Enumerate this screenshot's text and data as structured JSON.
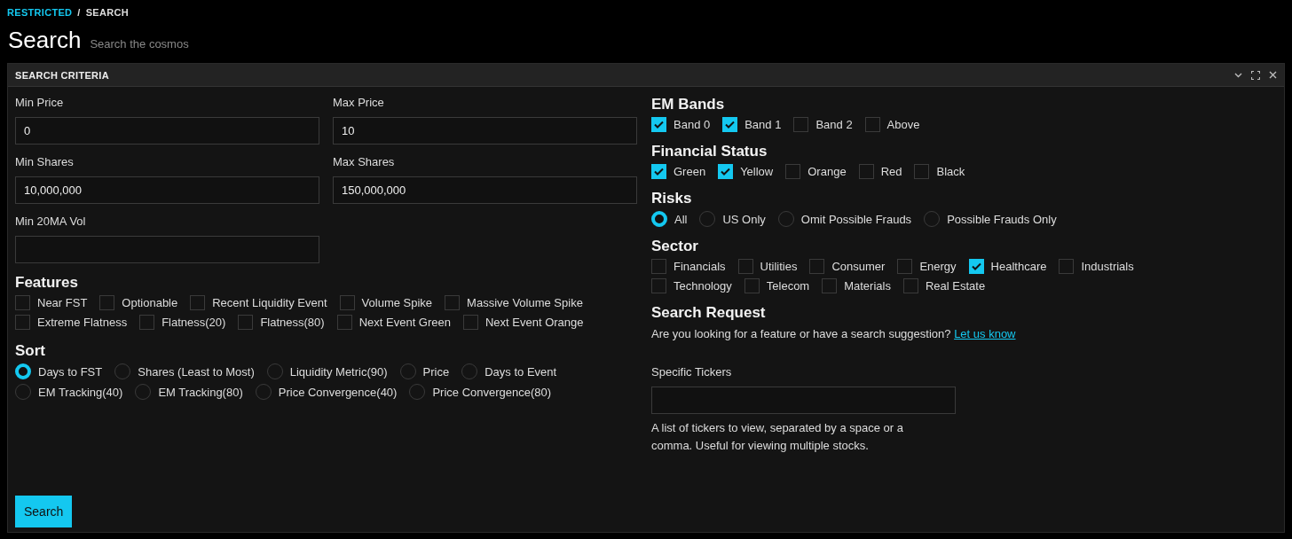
{
  "breadcrumb": {
    "items": [
      {
        "label": "RESTRICTED",
        "kind": "link"
      },
      {
        "label": "SEARCH",
        "kind": "current"
      }
    ],
    "separator": "/"
  },
  "header": {
    "title": "Search",
    "subtitle": "Search the cosmos"
  },
  "panel": {
    "title": "SEARCH CRITERIA"
  },
  "fields": [
    {
      "label": "Min Price",
      "value": "0"
    },
    {
      "label": "Max Price",
      "value": "10"
    },
    {
      "label": "Min Shares",
      "value": "10,000,000"
    },
    {
      "label": "Max Shares",
      "value": "150,000,000"
    },
    {
      "label": "Min 20MA Vol"
    }
  ],
  "features": {
    "title": "Features",
    "options": [
      {
        "label": "Near FST",
        "checked": false
      },
      {
        "label": "Optionable",
        "checked": false
      },
      {
        "label": "Recent Liquidity Event",
        "checked": false
      },
      {
        "label": "Volume Spike",
        "checked": false
      },
      {
        "label": "Massive Volume Spike",
        "checked": false
      },
      {
        "label": "Extreme Flatness",
        "checked": false
      },
      {
        "label": "Flatness(20)",
        "checked": false
      },
      {
        "label": "Flatness(80)",
        "checked": false
      },
      {
        "label": "Next Event Green",
        "checked": false
      },
      {
        "label": "Next Event Orange",
        "checked": false
      }
    ]
  },
  "sort": {
    "title": "Sort",
    "options": [
      {
        "label": "Days to FST",
        "selected": true
      },
      {
        "label": "Shares (Least to Most)",
        "selected": false
      },
      {
        "label": "Liquidity Metric(90)",
        "selected": false
      },
      {
        "label": "Price",
        "selected": false
      },
      {
        "label": "Days to Event",
        "selected": false
      },
      {
        "label": "EM Tracking(40)",
        "selected": false
      },
      {
        "label": "EM Tracking(80)",
        "selected": false
      },
      {
        "label": "Price Convergence(40)",
        "selected": false
      },
      {
        "label": "Price Convergence(80)",
        "selected": false
      }
    ]
  },
  "search_button": "Search",
  "em_bands": {
    "title": "EM Bands",
    "options": [
      {
        "label": "Band 0",
        "checked": true
      },
      {
        "label": "Band 1",
        "checked": true
      },
      {
        "label": "Band 2",
        "checked": false
      },
      {
        "label": "Above",
        "checked": false
      }
    ]
  },
  "financial_status": {
    "title": "Financial Status",
    "options": [
      {
        "label": "Green",
        "checked": true
      },
      {
        "label": "Yellow",
        "checked": true
      },
      {
        "label": "Orange",
        "checked": false
      },
      {
        "label": "Red",
        "checked": false
      },
      {
        "label": "Black",
        "checked": false
      }
    ]
  },
  "risks": {
    "title": "Risks",
    "options": [
      {
        "label": "All",
        "selected": true
      },
      {
        "label": "US Only",
        "selected": false
      },
      {
        "label": "Omit Possible Frauds",
        "selected": false
      },
      {
        "label": "Possible Frauds Only",
        "selected": false
      }
    ]
  },
  "sector": {
    "title": "Sector",
    "options": [
      {
        "label": "Financials",
        "checked": false
      },
      {
        "label": "Utilities",
        "checked": false
      },
      {
        "label": "Consumer",
        "checked": false
      },
      {
        "label": "Energy",
        "checked": false
      },
      {
        "label": "Healthcare",
        "checked": true
      },
      {
        "label": "Industrials",
        "checked": false
      },
      {
        "label": "Technology",
        "checked": false
      },
      {
        "label": "Telecom",
        "checked": false
      },
      {
        "label": "Materials",
        "checked": false
      },
      {
        "label": "Real Estate",
        "checked": false
      }
    ]
  },
  "search_request": {
    "title": "Search Request",
    "text": "Are you looking for a feature or have a search suggestion?",
    "link": "Let us know"
  },
  "specific_tickers": {
    "label": "Specific Tickers",
    "help": "A list of tickers to view, separated by a space or a comma. Useful for viewing multiple stocks."
  }
}
